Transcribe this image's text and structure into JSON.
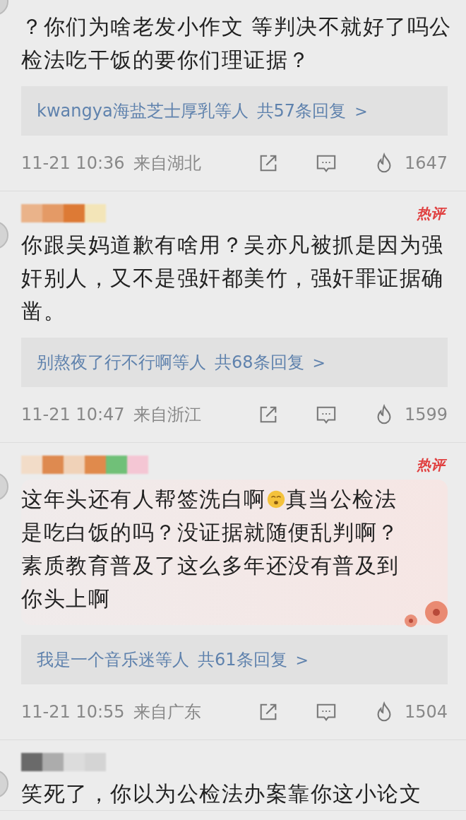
{
  "comments": [
    {
      "bubble": false,
      "body": [
        {
          "kind": "text",
          "text": "？你们为啥老发小作文 等判决不就好了吗公检法吃干饭的要你们理证据？"
        }
      ],
      "replies": {
        "names": "kwangya海盐芝士厚乳等人",
        "count": "共57条回复",
        "arrow": ">"
      },
      "time": "11-21 10:36",
      "location": "来自湖北",
      "likes": "1647"
    },
    {
      "author_blocks": [
        {
          "color": "#eab38a"
        },
        {
          "color": "#e49a66"
        },
        {
          "color": "#dd7a35"
        },
        {
          "color": "#f3e5b8"
        }
      ],
      "badge": "热评",
      "bubble": false,
      "body": [
        {
          "kind": "text",
          "text": "你跟吴妈道歉有啥用？吴亦凡被抓是因为强奸别人，又不是强奸都美竹，强奸罪证据确凿。"
        }
      ],
      "replies": {
        "names": "别熬夜了行不行啊等人",
        "count": "共68条回复",
        "arrow": ">"
      },
      "time": "11-21 10:47",
      "location": "来自浙江",
      "likes": "1599"
    },
    {
      "author_blocks": [
        {
          "color": "#f2dcc8"
        },
        {
          "color": "#de8a50"
        },
        {
          "color": "#f0d2b8"
        },
        {
          "color": "#e08a4c"
        },
        {
          "color": "#70c078"
        },
        {
          "color": "#f4c6d4"
        }
      ],
      "badge": "热评",
      "bubble": true,
      "body": [
        {
          "kind": "text",
          "text": "这年头还有人帮签洗白啊"
        },
        {
          "kind": "emoji"
        },
        {
          "kind": "text",
          "text": "真当公检法是吃白饭的吗？没证据就随便乱判啊？素质教育普及了这么多年还没有普及到你头上啊"
        }
      ],
      "replies": {
        "names": "我是一个音乐迷等人",
        "count": "共61条回复",
        "arrow": ">"
      },
      "time": "11-21 10:55",
      "location": "来自广东",
      "likes": "1504"
    },
    {
      "author_blocks": [
        {
          "color": "#6a6a6a"
        },
        {
          "color": "#acacac"
        },
        {
          "color": "#dcdcdc"
        },
        {
          "color": "#d4d4d4"
        }
      ],
      "bubble": false,
      "body": [
        {
          "kind": "text",
          "text": "笑死了，你以为公检法办案靠你这小论文"
        }
      ]
    }
  ]
}
